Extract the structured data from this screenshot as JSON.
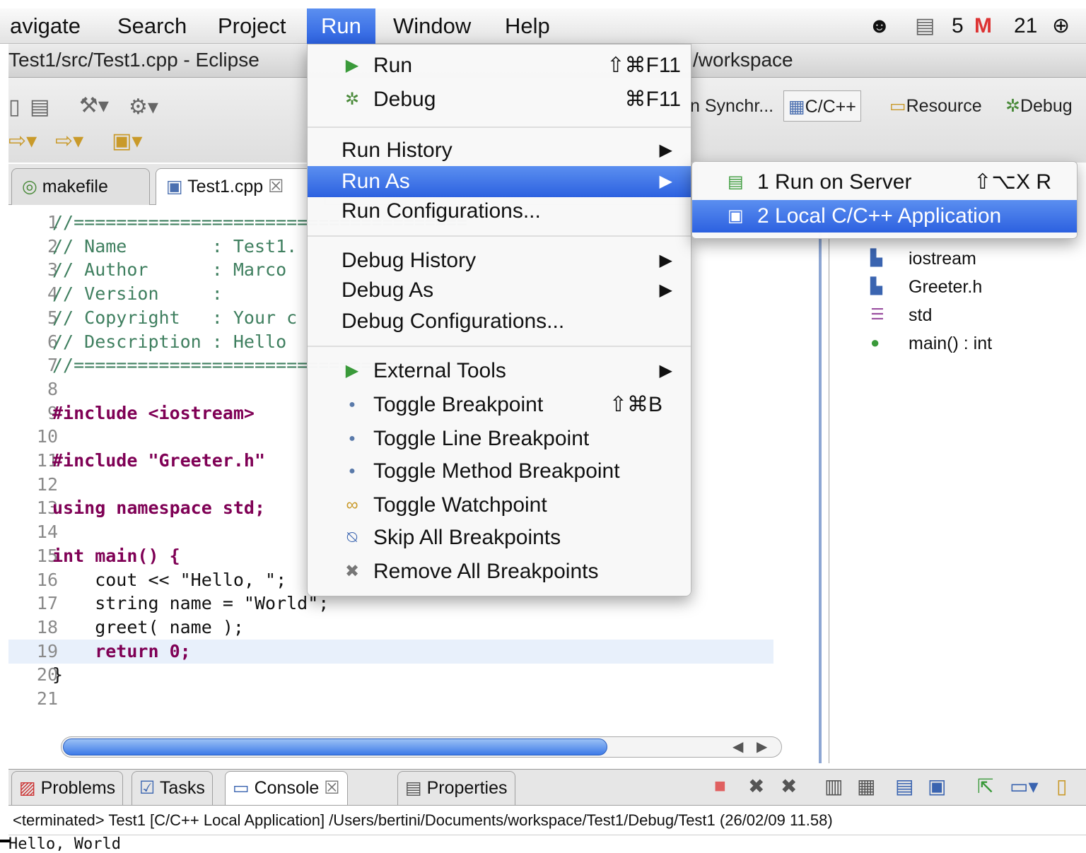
{
  "menubar": {
    "items": [
      "avigate",
      "Search",
      "Project",
      "Run",
      "Window",
      "Help"
    ],
    "tray": {
      "cal_count": "5",
      "mail_count": "21"
    }
  },
  "window": {
    "title_left": "Test1/src/Test1.cpp - Eclipse",
    "title_right": "/workspace"
  },
  "perspectives": [
    "n Synchr...",
    "C/C++",
    "Resource",
    "Debug"
  ],
  "editor": {
    "tabs": [
      "makefile",
      "Test1.cpp"
    ],
    "lines": [
      {
        "n": "1",
        "text": "//=====================================",
        "kind": "comment"
      },
      {
        "n": "2",
        "text": "// Name        : Test1.",
        "kind": "comment"
      },
      {
        "n": "3",
        "text": "// Author      : Marco",
        "kind": "comment"
      },
      {
        "n": "4",
        "text": "// Version     :",
        "kind": "comment"
      },
      {
        "n": "5",
        "text": "// Copyright   : Your c",
        "kind": "comment"
      },
      {
        "n": "6",
        "text": "// Description : Hello",
        "kind": "comment"
      },
      {
        "n": "7",
        "text": "//=====================================",
        "kind": "comment"
      },
      {
        "n": "8",
        "text": "",
        "kind": "plain"
      },
      {
        "n": "9",
        "text": "#include <iostream>",
        "kind": "include"
      },
      {
        "n": "10",
        "text": "",
        "kind": "plain"
      },
      {
        "n": "11",
        "text": "#include \"Greeter.h\"",
        "kind": "include"
      },
      {
        "n": "12",
        "text": "",
        "kind": "plain"
      },
      {
        "n": "13",
        "text": "using namespace std;",
        "kind": "using"
      },
      {
        "n": "14",
        "text": "",
        "kind": "plain"
      },
      {
        "n": "15",
        "text": "int main() {",
        "kind": "main"
      },
      {
        "n": "16",
        "text": "    cout << \"Hello, \";",
        "kind": "cout"
      },
      {
        "n": "17",
        "text": "    string name = \"World\";",
        "kind": "string"
      },
      {
        "n": "18",
        "text": "    greet( name );",
        "kind": "plain"
      },
      {
        "n": "19",
        "text": "    return 0;",
        "kind": "return"
      },
      {
        "n": "20",
        "text": "}",
        "kind": "plain"
      },
      {
        "n": "21",
        "text": "",
        "kind": "plain"
      }
    ]
  },
  "outline": {
    "items": [
      "iostream",
      "Greeter.h",
      "std",
      "main() : int"
    ]
  },
  "run_menu": {
    "run": {
      "label": "Run",
      "shortcut": "⇧⌘F11"
    },
    "debug": {
      "label": "Debug",
      "shortcut": "⌘F11"
    },
    "run_history": "Run History",
    "run_as": "Run As",
    "run_configurations": "Run Configurations...",
    "debug_history": "Debug History",
    "debug_as": "Debug As",
    "debug_configurations": "Debug Configurations...",
    "external_tools": "External Tools",
    "toggle_breakpoint": {
      "label": "Toggle Breakpoint",
      "shortcut": "⇧⌘B"
    },
    "toggle_line_breakpoint": "Toggle Line Breakpoint",
    "toggle_method_breakpoint": "Toggle Method Breakpoint",
    "toggle_watchpoint": "Toggle Watchpoint",
    "skip_all_breakpoints": "Skip All Breakpoints",
    "remove_all_breakpoints": "Remove All Breakpoints"
  },
  "run_as_submenu": [
    {
      "label": "1 Run on Server",
      "shortcut": "⇧⌥X R"
    },
    {
      "label": "2 Local C/C++ Application",
      "shortcut": ""
    }
  ],
  "bottom": {
    "tabs": [
      "Problems",
      "Tasks",
      "Console",
      "Properties"
    ],
    "console_header": "<terminated> Test1 [C/C++ Local Application] /Users/bertini/Documents/workspace/Test1/Debug/Test1 (26/02/09 11.58)",
    "console_output": "Hello, World"
  },
  "colors": {
    "accent": "#2c61e0",
    "comment": "#3f7f5f",
    "keyword": "#7f0055",
    "string": "#2a00ff"
  }
}
